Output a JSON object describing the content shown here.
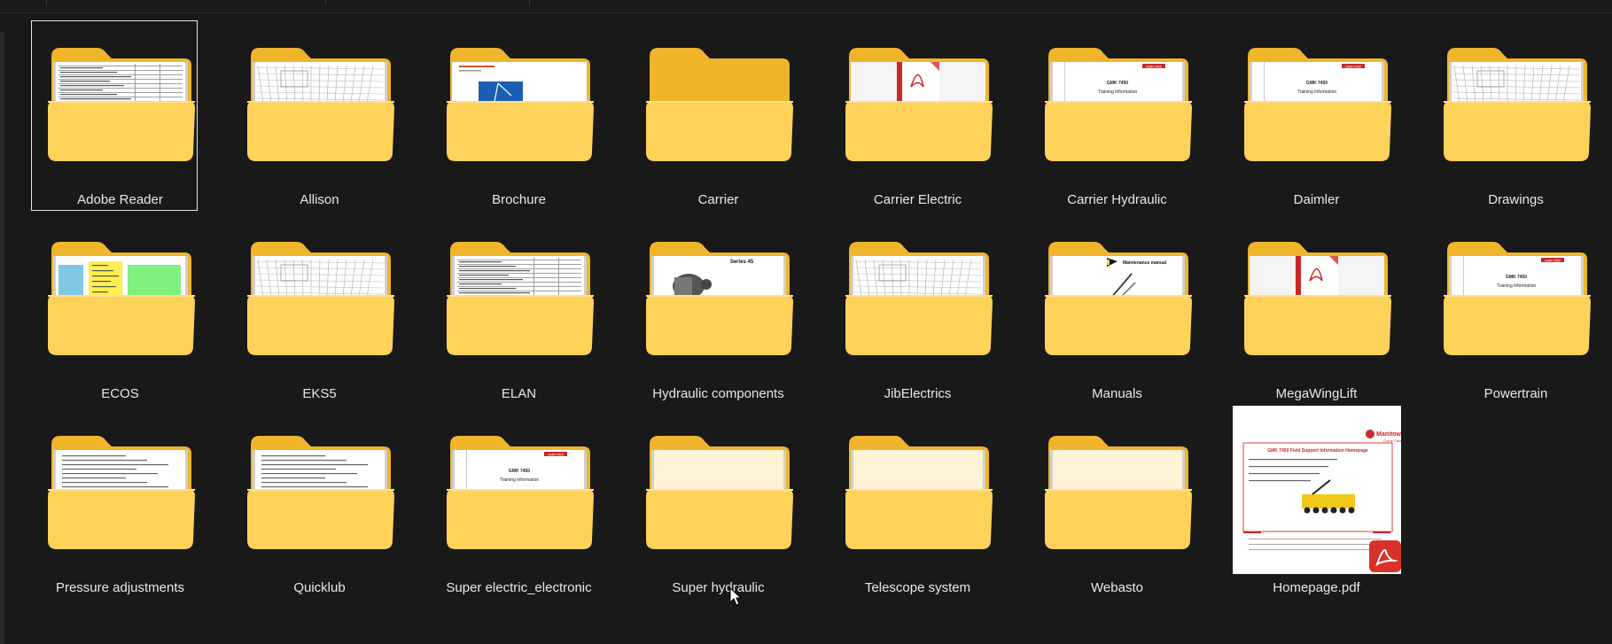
{
  "items": [
    {
      "name": "Adobe Reader",
      "type": "folder",
      "preview": "doc-table",
      "selected": true
    },
    {
      "name": "Allison",
      "type": "folder",
      "preview": "drawing"
    },
    {
      "name": "Brochure",
      "type": "folder",
      "preview": "brochure"
    },
    {
      "name": "Carrier",
      "type": "folder",
      "preview": "none"
    },
    {
      "name": "Carrier Electric",
      "type": "folder",
      "preview": "pdf"
    },
    {
      "name": "Carrier Hydraulic",
      "type": "folder",
      "preview": "training"
    },
    {
      "name": "Daimler",
      "type": "folder",
      "preview": "training"
    },
    {
      "name": "Drawings",
      "type": "folder",
      "preview": "drawing"
    },
    {
      "name": "ECOS",
      "type": "folder",
      "preview": "diagram-color"
    },
    {
      "name": "EKS5",
      "type": "folder",
      "preview": "drawing"
    },
    {
      "name": "ELAN",
      "type": "folder",
      "preview": "doc-table"
    },
    {
      "name": "Hydraulic components",
      "type": "folder",
      "preview": "series45"
    },
    {
      "name": "JibElectrics",
      "type": "folder",
      "preview": "drawing"
    },
    {
      "name": "Manuals",
      "type": "folder",
      "preview": "manual"
    },
    {
      "name": "MegaWingLift",
      "type": "folder",
      "preview": "pdf"
    },
    {
      "name": "Powertrain",
      "type": "folder",
      "preview": "training"
    },
    {
      "name": "Pressure adjustments",
      "type": "folder",
      "preview": "doc-text"
    },
    {
      "name": "Quicklub",
      "type": "folder",
      "preview": "doc-text"
    },
    {
      "name": "Super electric_electronic",
      "type": "folder",
      "preview": "training"
    },
    {
      "name": "Super hydraulic",
      "type": "folder",
      "preview": "empty-paper"
    },
    {
      "name": "Telescope system",
      "type": "folder",
      "preview": "empty-paper"
    },
    {
      "name": "Webasto",
      "type": "folder",
      "preview": "empty-paper"
    },
    {
      "name": "Homepage.pdf",
      "type": "pdf",
      "preview": "pdf-page"
    }
  ],
  "preview_text": {
    "training_badge": "GMK7450",
    "training_model": "GMK 7450",
    "training_title": "Training Information",
    "series45": "Series 45",
    "manual": "Maintenance manual",
    "pdf_brand": "Manitowoc",
    "pdf_brand_sub": "Crane Care",
    "pdf_title": "GMK 7450 Field Support Information Homepage"
  },
  "colors": {
    "background": "#191919",
    "folder_back": "#f0b52a",
    "folder_front": "#ffd25a",
    "label": "#e8e8e8",
    "selection": "#e6e6e6",
    "pdf_red": "#d9322a"
  }
}
